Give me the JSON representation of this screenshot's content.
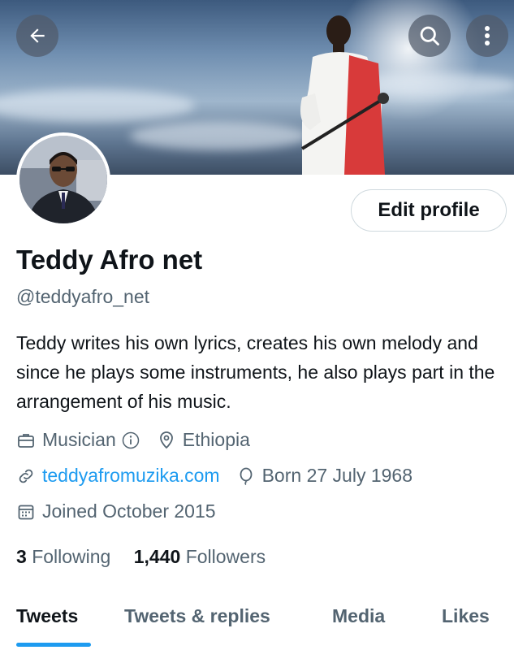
{
  "profile": {
    "display_name": "Teddy Afro net",
    "handle": "@teddyafro_net",
    "bio": "Teddy writes his own lyrics, creates his own melody and since he plays some instruments, he also plays part in the arrangement of his music.",
    "category": "Musician",
    "location": "Ethiopia",
    "website": "teddyafromuzika.com",
    "birthday": "Born 27 July 1968",
    "joined": "Joined October 2015"
  },
  "stats": {
    "following_count": "3",
    "following_label": "Following",
    "followers_count": "1,440",
    "followers_label": "Followers"
  },
  "actions": {
    "edit_profile_label": "Edit profile"
  },
  "tabs": [
    {
      "label": "Tweets",
      "active": true
    },
    {
      "label": "Tweets & replies",
      "active": false
    },
    {
      "label": "Media",
      "active": false
    },
    {
      "label": "Likes",
      "active": false
    }
  ],
  "icons": {
    "back": "arrow-left-icon",
    "search": "search-icon",
    "more": "more-vertical-icon",
    "category": "briefcase-icon",
    "info": "info-icon",
    "location": "location-pin-icon",
    "website": "link-icon",
    "birthday": "balloon-icon",
    "joined": "calendar-icon"
  },
  "colors": {
    "accent": "#1d9bf0",
    "text_primary": "#0f1419",
    "text_secondary": "#536471",
    "border": "#cfd9de"
  }
}
